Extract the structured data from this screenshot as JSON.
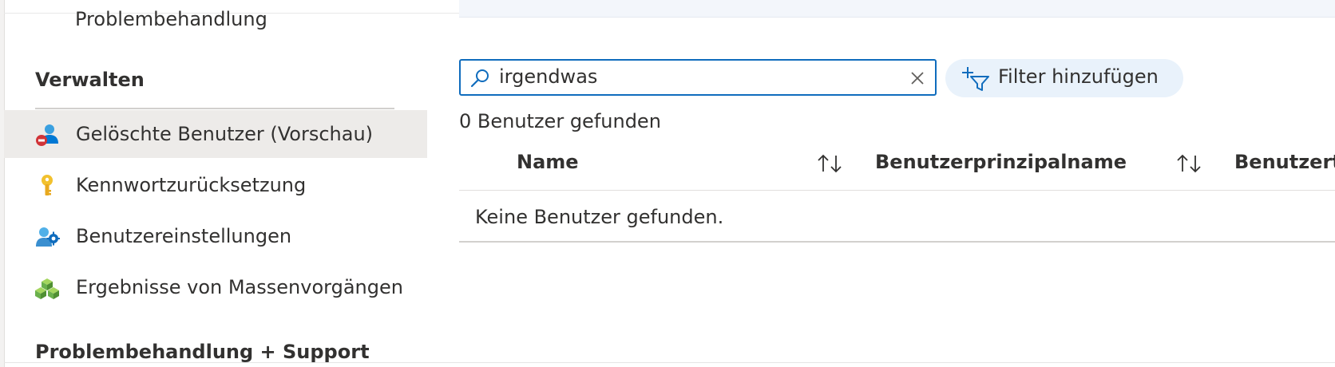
{
  "sidebar": {
    "cut_item_label": "Problembehandlung",
    "section_manage": "Verwalten",
    "items": [
      {
        "label": "Gelöschte Benutzer (Vorschau)",
        "icon": "deleted-user-icon",
        "active": true
      },
      {
        "label": "Kennwortzurücksetzung",
        "icon": "key-icon",
        "active": false
      },
      {
        "label": "Benutzereinstellungen",
        "icon": "user-settings-icon",
        "active": false
      },
      {
        "label": "Ergebnisse von Massenvorgängen",
        "icon": "bulk-operations-icon",
        "active": false
      }
    ],
    "section_support": "Problembehandlung + Support"
  },
  "search": {
    "value": "irgendwas",
    "icon": "search-icon",
    "clear_icon": "close-icon"
  },
  "filter": {
    "label": "Filter hinzufügen",
    "icon": "add-filter-icon"
  },
  "results": {
    "count_text": "0 Benutzer gefunden",
    "empty_message": "Keine Benutzer gefunden."
  },
  "table": {
    "columns": [
      "Name",
      "Benutzerprinzipalname",
      "Benutzerty"
    ]
  },
  "colors": {
    "accent": "#0f6cbd",
    "active_bg": "#edebe9",
    "pill_bg": "#e9f2fb"
  }
}
